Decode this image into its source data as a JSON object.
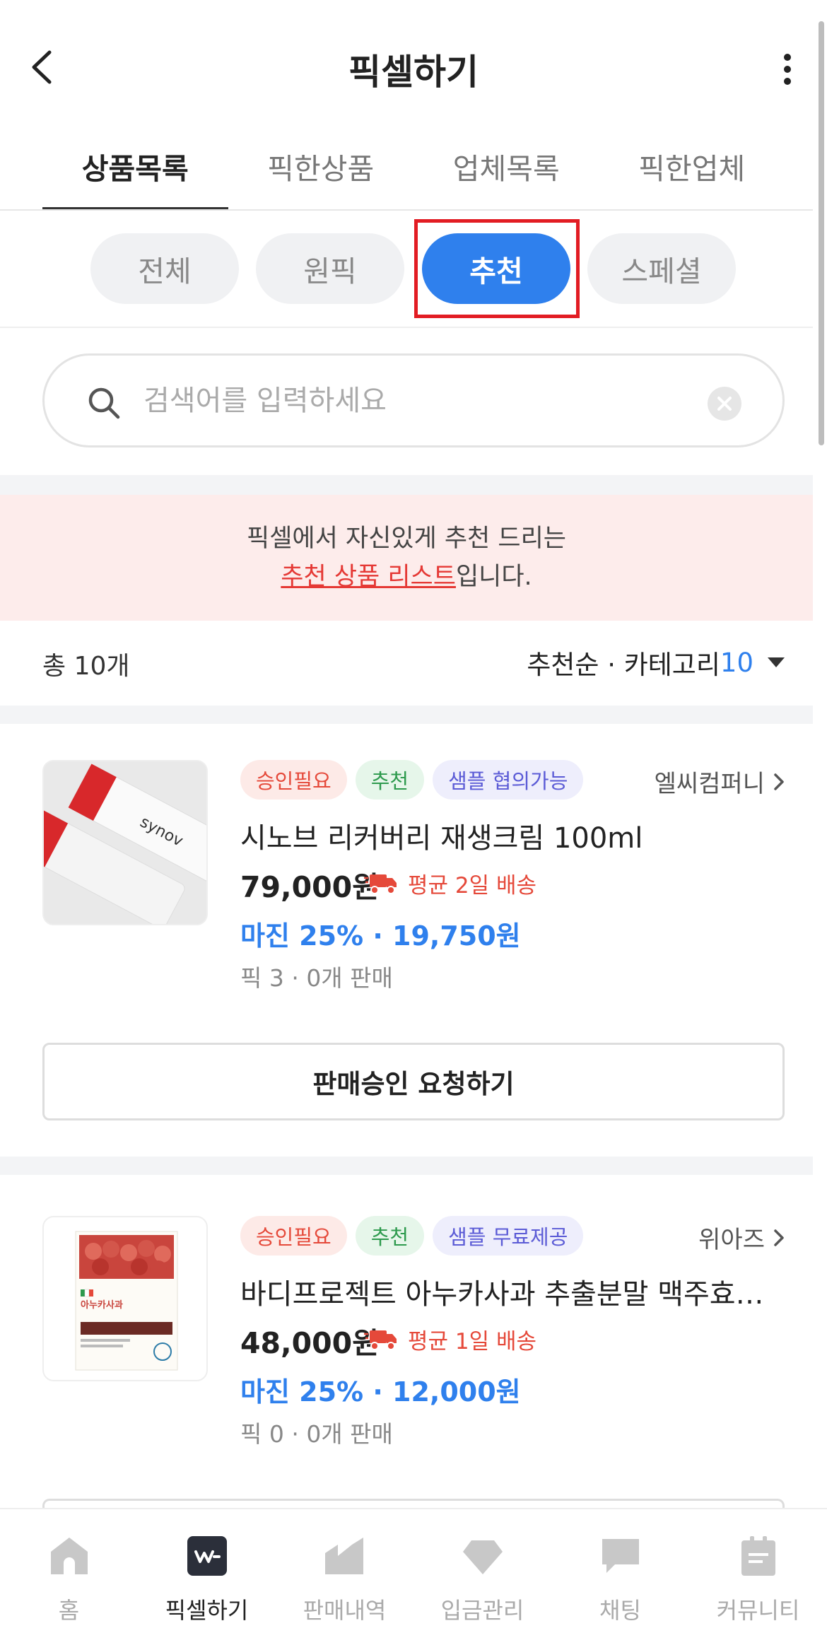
{
  "header": {
    "title": "픽셀하기"
  },
  "tabs": [
    {
      "label": "상품목록",
      "active": true
    },
    {
      "label": "픽한상품",
      "active": false
    },
    {
      "label": "업체목록",
      "active": false
    },
    {
      "label": "픽한업체",
      "active": false
    }
  ],
  "chips": [
    {
      "label": "전체",
      "active": false
    },
    {
      "label": "원픽",
      "active": false
    },
    {
      "label": "추천",
      "active": true
    },
    {
      "label": "스페셜",
      "active": false
    }
  ],
  "search": {
    "placeholder": "검색어를 입력하세요",
    "value": ""
  },
  "banner": {
    "line1": "픽셀에서 자신있게 추천 드리는",
    "link": "추천 상품 리스트",
    "line2_suffix": "입니다."
  },
  "list": {
    "count": "총 10개",
    "sort": "추천순 · 카테고리",
    "category_count": "10"
  },
  "products": [
    {
      "badges": [
        "승인필요",
        "추천",
        "샘플 협의가능"
      ],
      "vendor": "엘씨컴퍼니",
      "name": "시노브 리커버리 재생크림 100ml",
      "price": "79,000원",
      "shipping": "평균 2일 배송",
      "margin": "마진 25% · 19,750원",
      "meta": "픽 3 · 0개 판매",
      "button": "판매승인 요청하기",
      "thumb_text": "synov"
    },
    {
      "badges": [
        "승인필요",
        "추천",
        "샘플 무료제공"
      ],
      "vendor": "위아즈",
      "name": "바디프로젝트 아누카사과 추출분말 맥주효모 비오틴 PLUS",
      "price": "48,000원",
      "shipping": "평균 1일 배송",
      "margin": "마진 25% · 12,000원",
      "meta": "픽 0 · 0개 판매",
      "thumb_text": "아누카사과"
    }
  ],
  "bottom_nav": [
    {
      "label": "홈",
      "icon": "home-icon",
      "active": false
    },
    {
      "label": "픽셀하기",
      "icon": "pixel-logo-icon",
      "active": true
    },
    {
      "label": "판매내역",
      "icon": "sales-chart-icon",
      "active": false
    },
    {
      "label": "입금관리",
      "icon": "diamond-icon",
      "active": false
    },
    {
      "label": "채팅",
      "icon": "chat-icon",
      "active": false
    },
    {
      "label": "커뮤니티",
      "icon": "clipboard-icon",
      "active": false
    }
  ],
  "colors": {
    "accent": "#2f80ed",
    "highlight": "#e21c23",
    "banner_bg": "#fdeceb"
  }
}
